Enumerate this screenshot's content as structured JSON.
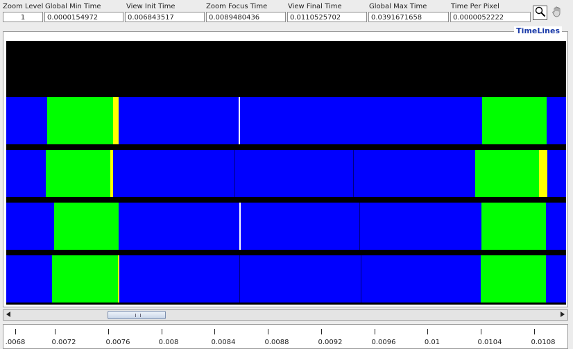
{
  "fields": [
    {
      "label": "Zoom Level",
      "value": "1"
    },
    {
      "label": "Global Min Time",
      "value": "0.0000154972"
    },
    {
      "label": "View  Init Time",
      "value": "0.006843517"
    },
    {
      "label": "Zoom Focus Time",
      "value": "0.0089480436"
    },
    {
      "label": "View Final Time",
      "value": "0.0110525702"
    },
    {
      "label": "Global Max Time",
      "value": "0.0391671658"
    },
    {
      "label": "Time Per Pixel",
      "value": "0.0000052222"
    }
  ],
  "tools": {
    "zoom": "magnifier-icon",
    "pan": "hand-icon"
  },
  "panel_title": "TimeLines",
  "colors": {
    "running": "#0000ff",
    "green": "#00ff00",
    "yellow": "#ffff00",
    "white": "#ffffff",
    "background": "#000000",
    "title": "#1a3aa8"
  },
  "ruler_labels": [
    ".0068",
    "0.0072",
    "0.0076",
    "0.008",
    "0.0084",
    "0.0088",
    "0.0092",
    "0.0096",
    "0.01",
    "0.0104",
    "0.0108"
  ]
}
